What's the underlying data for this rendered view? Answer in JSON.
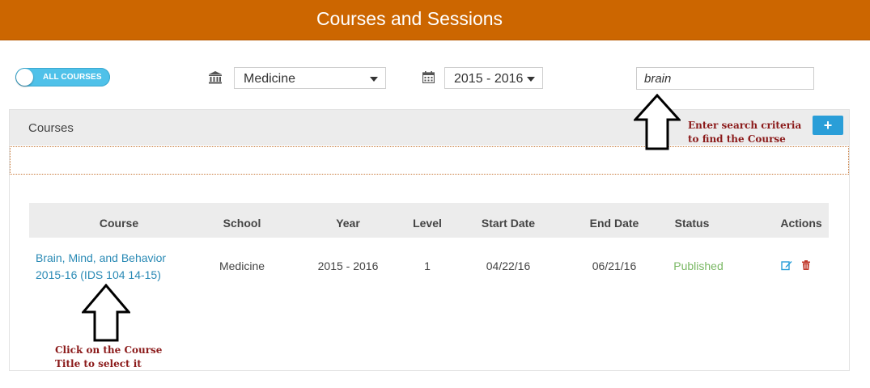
{
  "header": {
    "title": "Courses and Sessions"
  },
  "filters": {
    "toggle_label": "ALL COURSES",
    "school_icon": "university-icon",
    "school": "Medicine",
    "calendar_icon": "calendar-icon",
    "year": "2015 - 2016",
    "search_value": "brain"
  },
  "panel": {
    "title": "Courses",
    "add_button": "+"
  },
  "table": {
    "columns": [
      "Course",
      "School",
      "Year",
      "Level",
      "Start Date",
      "End Date",
      "Status",
      "Actions"
    ],
    "rows": [
      {
        "course_line1": "Brain, Mind, and Behavior",
        "course_line2": "2015-16 (IDS 104 14-15)",
        "school": "Medicine",
        "year": "2015 - 2016",
        "level": "1",
        "start_date": "04/22/16",
        "end_date": "06/21/16",
        "status": "Published",
        "actions": [
          "edit-icon",
          "trash-icon"
        ]
      }
    ]
  },
  "annotations": {
    "search_line1": "Enter search criteria",
    "search_line2": "to find the Course",
    "course_line1": "Click on the Course",
    "course_line2": "Title to select it"
  },
  "colors": {
    "header_bg": "#cc6600",
    "toggle": "#4fc1e9",
    "link": "#2a8ab5",
    "published": "#7ab864",
    "annotation": "#8b1a1a",
    "add_button": "#2a9ed8"
  }
}
